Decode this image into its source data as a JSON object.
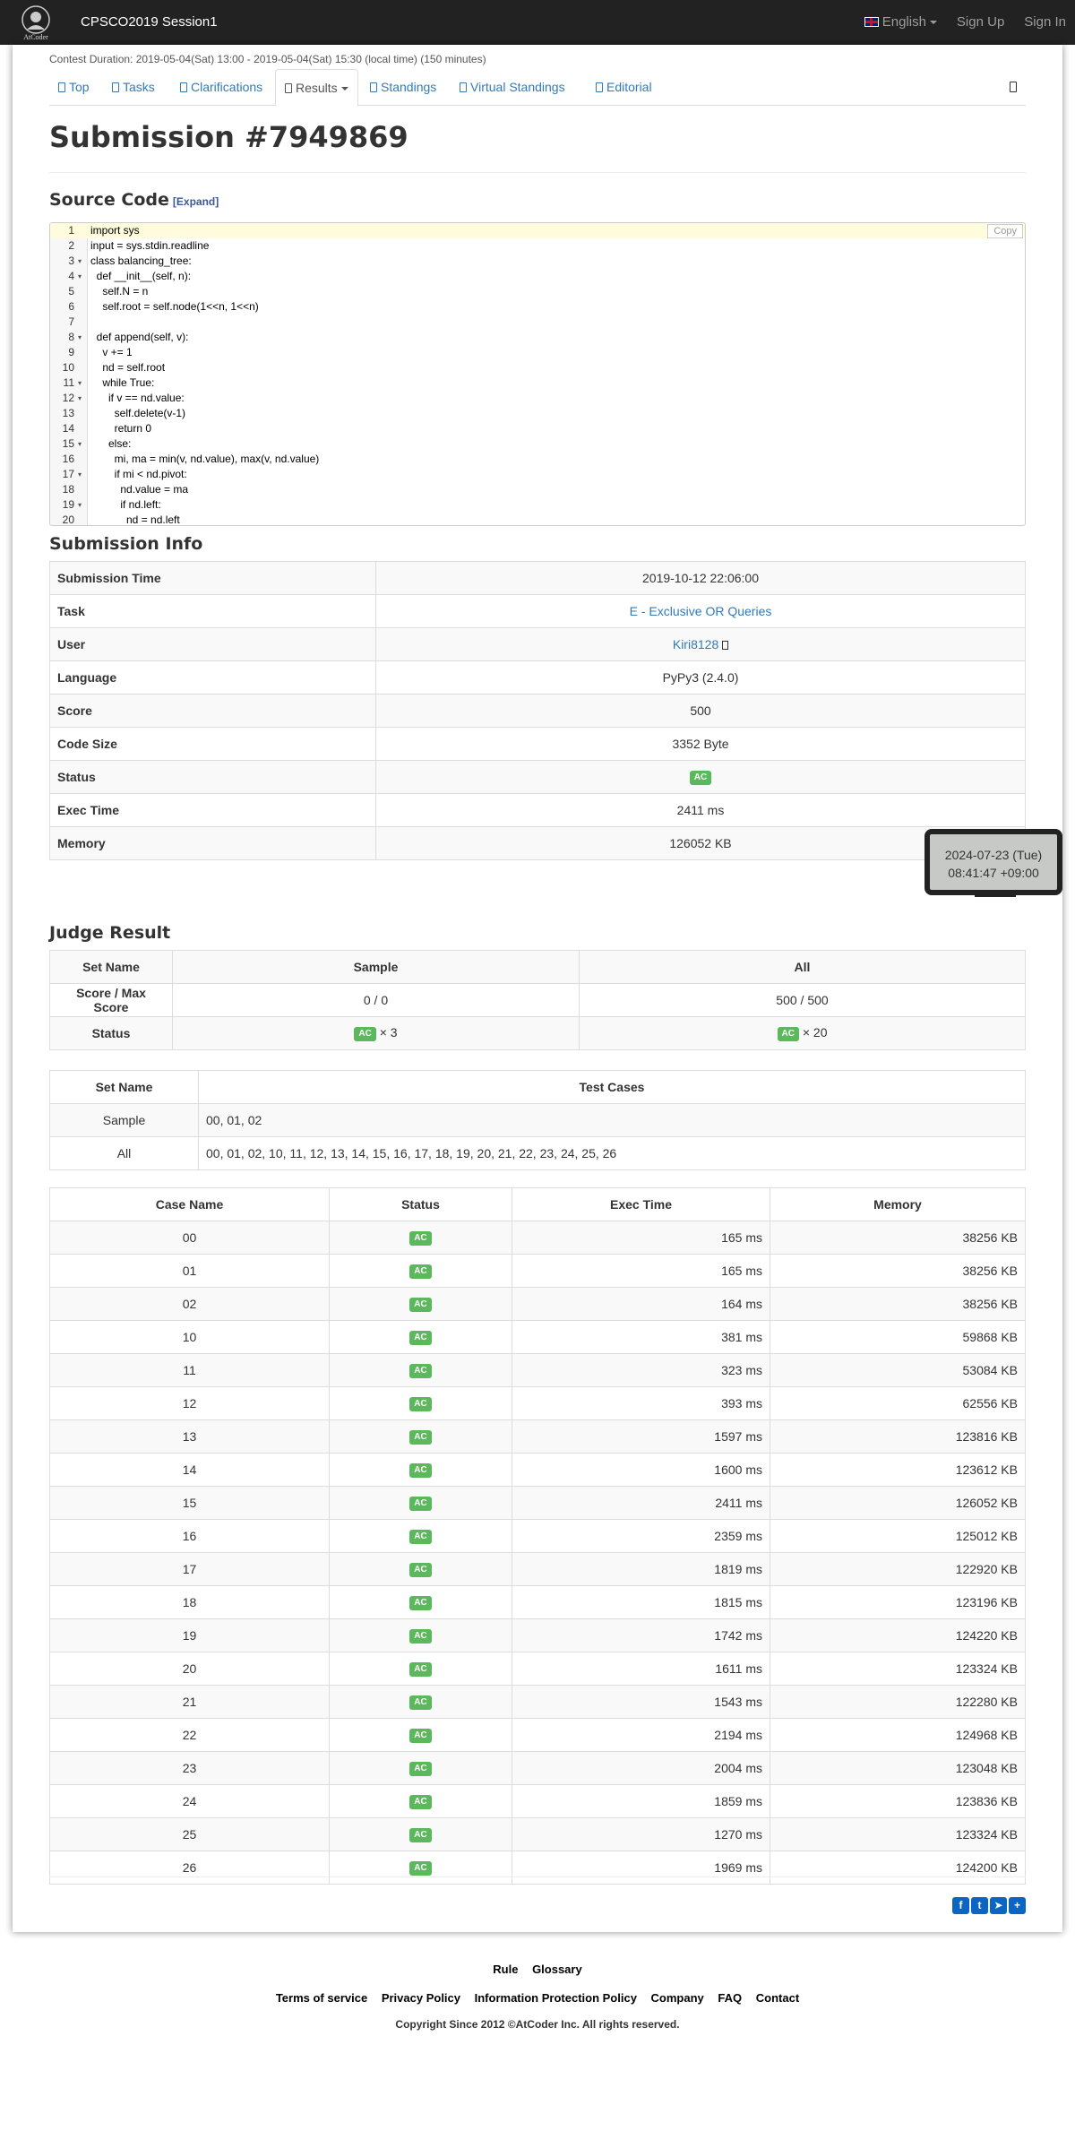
{
  "header": {
    "logo_text": "AtCoder",
    "contest_title": "CPSCO2019 Session1",
    "language": "English",
    "sign_up": "Sign Up",
    "sign_in": "Sign In"
  },
  "contest_duration": "Contest Duration: 2019-05-04(Sat) 13:00 - 2019-05-04(Sat) 15:30 (local time) (150 minutes)",
  "tabs": [
    {
      "label": "Top"
    },
    {
      "label": "Tasks"
    },
    {
      "label": "Clarifications"
    },
    {
      "label": "Results"
    },
    {
      "label": "Standings"
    },
    {
      "label": "Virtual Standings"
    },
    {
      "label": "Editorial"
    }
  ],
  "page_title": "Submission #7949869",
  "source_code": {
    "heading": "Source Code",
    "expand_label": "[Expand]",
    "copy_label": "Copy",
    "lines": [
      {
        "n": "1",
        "text": "import sys",
        "fold": false
      },
      {
        "n": "2",
        "text": "input = sys.stdin.readline",
        "fold": false
      },
      {
        "n": "3",
        "text": "class balancing_tree:",
        "fold": true
      },
      {
        "n": "4",
        "text": "  def __init__(self, n):",
        "fold": true
      },
      {
        "n": "5",
        "text": "    self.N = n",
        "fold": false
      },
      {
        "n": "6",
        "text": "    self.root = self.node(1<<n, 1<<n)",
        "fold": false
      },
      {
        "n": "7",
        "text": "",
        "fold": false
      },
      {
        "n": "8",
        "text": "  def append(self, v):",
        "fold": true
      },
      {
        "n": "9",
        "text": "    v += 1",
        "fold": false
      },
      {
        "n": "10",
        "text": "    nd = self.root",
        "fold": false
      },
      {
        "n": "11",
        "text": "    while True:",
        "fold": true
      },
      {
        "n": "12",
        "text": "      if v == nd.value:",
        "fold": true
      },
      {
        "n": "13",
        "text": "        self.delete(v-1)",
        "fold": false
      },
      {
        "n": "14",
        "text": "        return 0",
        "fold": false
      },
      {
        "n": "15",
        "text": "      else:",
        "fold": true
      },
      {
        "n": "16",
        "text": "        mi, ma = min(v, nd.value), max(v, nd.value)",
        "fold": false
      },
      {
        "n": "17",
        "text": "        if mi < nd.pivot:",
        "fold": true
      },
      {
        "n": "18",
        "text": "          nd.value = ma",
        "fold": false
      },
      {
        "n": "19",
        "text": "          if nd.left:",
        "fold": true
      },
      {
        "n": "20",
        "text": "            nd = nd.left",
        "fold": false
      }
    ]
  },
  "submission_info": {
    "heading": "Submission Info",
    "rows": [
      {
        "label": "Submission Time",
        "value": "2019-10-12 22:06:00"
      },
      {
        "label": "Task",
        "value": "E - Exclusive OR Queries"
      },
      {
        "label": "User",
        "value": "Kiri8128"
      },
      {
        "label": "Language",
        "value": "PyPy3 (2.4.0)"
      },
      {
        "label": "Score",
        "value": "500"
      },
      {
        "label": "Code Size",
        "value": "3352 Byte"
      },
      {
        "label": "Status",
        "value": "AC"
      },
      {
        "label": "Exec Time",
        "value": "2411 ms"
      },
      {
        "label": "Memory",
        "value": "126052 KB"
      }
    ]
  },
  "tooltip": {
    "line1": "2024-07-23 (Tue)",
    "line2": "08:41:47 +09:00"
  },
  "judge_result": {
    "heading": "Judge Result",
    "summary_headers": [
      "Set Name",
      "Sample",
      "All"
    ],
    "score_label": "Score / Max Score",
    "sample_score": "0 / 0",
    "all_score": "500 / 500",
    "status_label": "Status",
    "sample_status": "AC",
    "sample_count": "× 3",
    "all_status": "AC",
    "all_count": "× 20",
    "sets_headers": [
      "Set Name",
      "Test Cases"
    ],
    "sets": [
      {
        "name": "Sample",
        "cases": "00, 01, 02"
      },
      {
        "name": "All",
        "cases": "00, 01, 02, 10, 11, 12, 13, 14, 15, 16, 17, 18, 19, 20, 21, 22, 23, 24, 25, 26"
      }
    ],
    "case_headers": [
      "Case Name",
      "Status",
      "Exec Time",
      "Memory"
    ],
    "cases": [
      {
        "name": "00",
        "status": "AC",
        "time": "165 ms",
        "memory": "38256 KB"
      },
      {
        "name": "01",
        "status": "AC",
        "time": "165 ms",
        "memory": "38256 KB"
      },
      {
        "name": "02",
        "status": "AC",
        "time": "164 ms",
        "memory": "38256 KB"
      },
      {
        "name": "10",
        "status": "AC",
        "time": "381 ms",
        "memory": "59868 KB"
      },
      {
        "name": "11",
        "status": "AC",
        "time": "323 ms",
        "memory": "53084 KB"
      },
      {
        "name": "12",
        "status": "AC",
        "time": "393 ms",
        "memory": "62556 KB"
      },
      {
        "name": "13",
        "status": "AC",
        "time": "1597 ms",
        "memory": "123816 KB"
      },
      {
        "name": "14",
        "status": "AC",
        "time": "1600 ms",
        "memory": "123612 KB"
      },
      {
        "name": "15",
        "status": "AC",
        "time": "2411 ms",
        "memory": "126052 KB"
      },
      {
        "name": "16",
        "status": "AC",
        "time": "2359 ms",
        "memory": "125012 KB"
      },
      {
        "name": "17",
        "status": "AC",
        "time": "1819 ms",
        "memory": "122920 KB"
      },
      {
        "name": "18",
        "status": "AC",
        "time": "1815 ms",
        "memory": "123196 KB"
      },
      {
        "name": "19",
        "status": "AC",
        "time": "1742 ms",
        "memory": "124220 KB"
      },
      {
        "name": "20",
        "status": "AC",
        "time": "1611 ms",
        "memory": "123324 KB"
      },
      {
        "name": "21",
        "status": "AC",
        "time": "1543 ms",
        "memory": "122280 KB"
      },
      {
        "name": "22",
        "status": "AC",
        "time": "2194 ms",
        "memory": "124968 KB"
      },
      {
        "name": "23",
        "status": "AC",
        "time": "2004 ms",
        "memory": "123048 KB"
      },
      {
        "name": "24",
        "status": "AC",
        "time": "1859 ms",
        "memory": "123836 KB"
      },
      {
        "name": "25",
        "status": "AC",
        "time": "1270 ms",
        "memory": "123324 KB"
      },
      {
        "name": "26",
        "status": "AC",
        "time": "1969 ms",
        "memory": "124200 KB"
      }
    ]
  },
  "share_icons": [
    "facebook-icon",
    "twitter-icon",
    "telegram-icon",
    "plus-icon"
  ],
  "footer": {
    "links1": [
      "Rule",
      "Glossary"
    ],
    "links2": [
      "Terms of service",
      "Privacy Policy",
      "Information Protection Policy",
      "Company",
      "FAQ",
      "Contact"
    ],
    "copyright": "Copyright Since 2012 ©AtCoder Inc. All rights reserved."
  },
  "colors": {
    "accent": "#337ab7",
    "ac_badge": "#5cb85c",
    "topbar": "#222222"
  }
}
